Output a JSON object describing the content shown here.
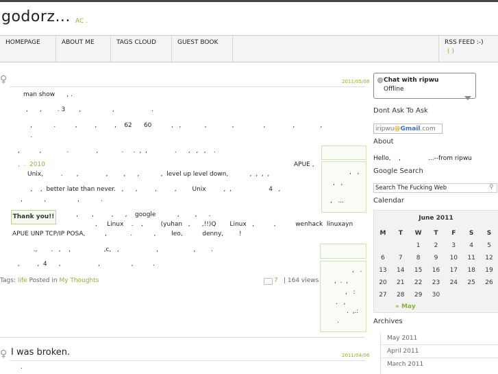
{
  "site": {
    "title": "godorz...",
    "subtitle": "AC ."
  },
  "nav": {
    "items": [
      {
        "label": "HOMEPAGE"
      },
      {
        "label": "ABOUT ME"
      },
      {
        "label": "TAGS CLOUD"
      },
      {
        "label": "GUEST BOOK"
      }
    ],
    "rss_label": "RSS FEED :-)",
    "rss_sub": "( )"
  },
  "post1": {
    "date": "2011/05/08",
    "lines": [
      "man show      , .",
      ",      ,        . 3       ,                ,                   .",
      ",           .          ,         ,         ,    62      60          ,   ,            ,             ,               ,              ,             ,",
      "     .",
      ",          ,             .              ,            .     .  ,  ,              .      ,   ,   ,    .",
      "       Unix,         .       ,              ,        ,      ,           ,  level up level down,           ,  ,  ,  ,",
      "   ,    ,  better late than never.   ,      ,         ,         ,        Unix         ,  ,                   4   ,",
      ",           ,                ,           .",
      "      ,       ,         ,      ,    google           ,        ,      .",
      "        ,     Linux    .    ,         (yuhan   ,      ,!!)Q       Linux   ,          ,          wenhack  linuxayn       ,",
      "APUE UNP TCP/IP POSA,          ,            .           ,        leo,          denny,        !",
      "          .,       .   ,    ,                 ,c,   ,                   ,                  ,        .",
      "  ,         ,  4      ,                   ,                ,          ."
    ],
    "link_text": "2010",
    "link_prefix": ",  .",
    "apue_text": "APUE ,",
    "thanks_label": "Thank you!!",
    "side_box_text": [
      ",   ,",
      ",   ,",
      ",   ...",
      ",   .",
      ",  .  ,",
      ",   :",
      ".   ,",
      ".  ,.:",
      "."
    ],
    "footer": {
      "tags_prefix": "Tags:",
      "tag": "life",
      "posted_in": "Posted in",
      "category": "My Thoughts",
      "comments": "7",
      "views": "| 164 views"
    }
  },
  "post2": {
    "title": "I was broken.",
    "date": "2011/04/06",
    "first_line": "."
  },
  "sidebar": {
    "chat_title": "Chat with ripwu",
    "chat_status": "Offline",
    "section_dont_ask": "Dont Ask To Ask",
    "gmail_user": "iripwu",
    "gmail_at": "@",
    "gmail_word": "Gmail",
    "gmail_tld": ".com",
    "section_about": "About",
    "about_text": "Hello,    ,              ...--from ripwu",
    "section_search": "Google Search",
    "search_placeholder": "Search The Fucking Web",
    "section_calendar": "Calendar",
    "calendar": {
      "month": "June 2011",
      "weekdays": [
        "M",
        "T",
        "W",
        "T",
        "F",
        "S",
        "S"
      ],
      "weeks": [
        [
          "",
          "",
          "1",
          "2",
          "3",
          "4",
          "5"
        ],
        [
          "6",
          "7",
          "8",
          "9",
          "10",
          "11",
          "12"
        ],
        [
          "13",
          "14",
          "15",
          "16",
          "17",
          "18",
          "19"
        ],
        [
          "20",
          "21",
          "22",
          "23",
          "24",
          "25",
          "26"
        ],
        [
          "27",
          "28",
          "29",
          "30",
          "",
          "",
          ""
        ]
      ],
      "prev": "« May"
    },
    "section_archives": "Archives",
    "archives": [
      "May 2011",
      "April 2011",
      "March 2011"
    ]
  },
  "colors": {
    "accent": "#8ab62d",
    "text": "#222222"
  }
}
